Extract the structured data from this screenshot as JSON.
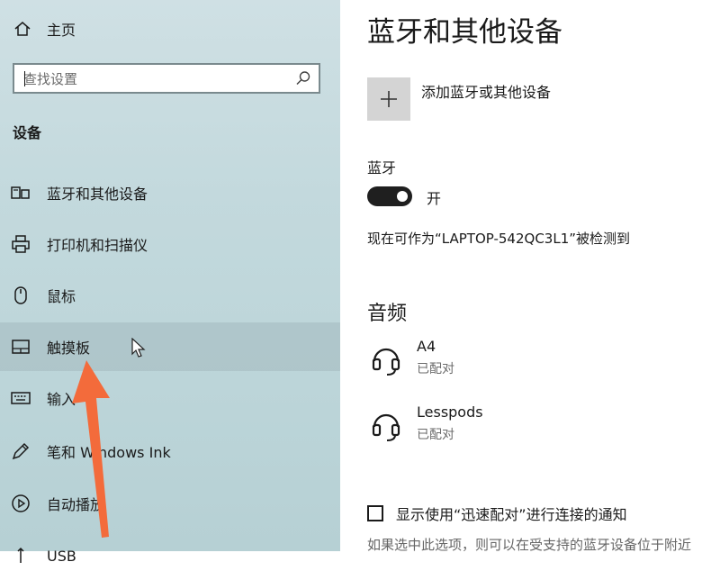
{
  "sidebar": {
    "home_label": "主页",
    "search_placeholder": "查找设置",
    "section_title": "设备",
    "items": [
      {
        "label": "蓝牙和其他设备",
        "icon": "bluetooth-devices-icon"
      },
      {
        "label": "打印机和扫描仪",
        "icon": "printer-icon"
      },
      {
        "label": "鼠标",
        "icon": "mouse-icon"
      },
      {
        "label": "触摸板",
        "icon": "touchpad-icon",
        "selected": true
      },
      {
        "label": "输入",
        "icon": "keyboard-icon"
      },
      {
        "label": "笔和 Windows Ink",
        "icon": "pen-icon"
      },
      {
        "label": "自动播放",
        "icon": "autoplay-icon"
      },
      {
        "label": "USB",
        "icon": "usb-icon"
      }
    ]
  },
  "main": {
    "title": "蓝牙和其他设备",
    "add_device_label": "添加蓝牙或其他设备",
    "bluetooth_label": "蓝牙",
    "bluetooth_toggle_state": "开",
    "bluetooth_on": true,
    "discoverable_text": "现在可作为“LAPTOP-542QC3L1”被检测到",
    "audio_section_title": "音频",
    "audio_devices": [
      {
        "name": "A4",
        "status": "已配对",
        "icon": "headset-icon"
      },
      {
        "name": "Lesspods",
        "status": "已配对",
        "icon": "headset-icon"
      }
    ],
    "swift_pair_label": "显示使用“迅速配对”进行连接的通知",
    "swift_pair_checked": false,
    "footnote": "如果选中此选项，则可以在受支持的蓝牙设备位于附近"
  },
  "colors": {
    "sidebar_bg": "#c3d9dd",
    "arrow": "#f36b3b",
    "toggle_on": "#1f1f1f",
    "add_tile": "#d4d4d4"
  }
}
